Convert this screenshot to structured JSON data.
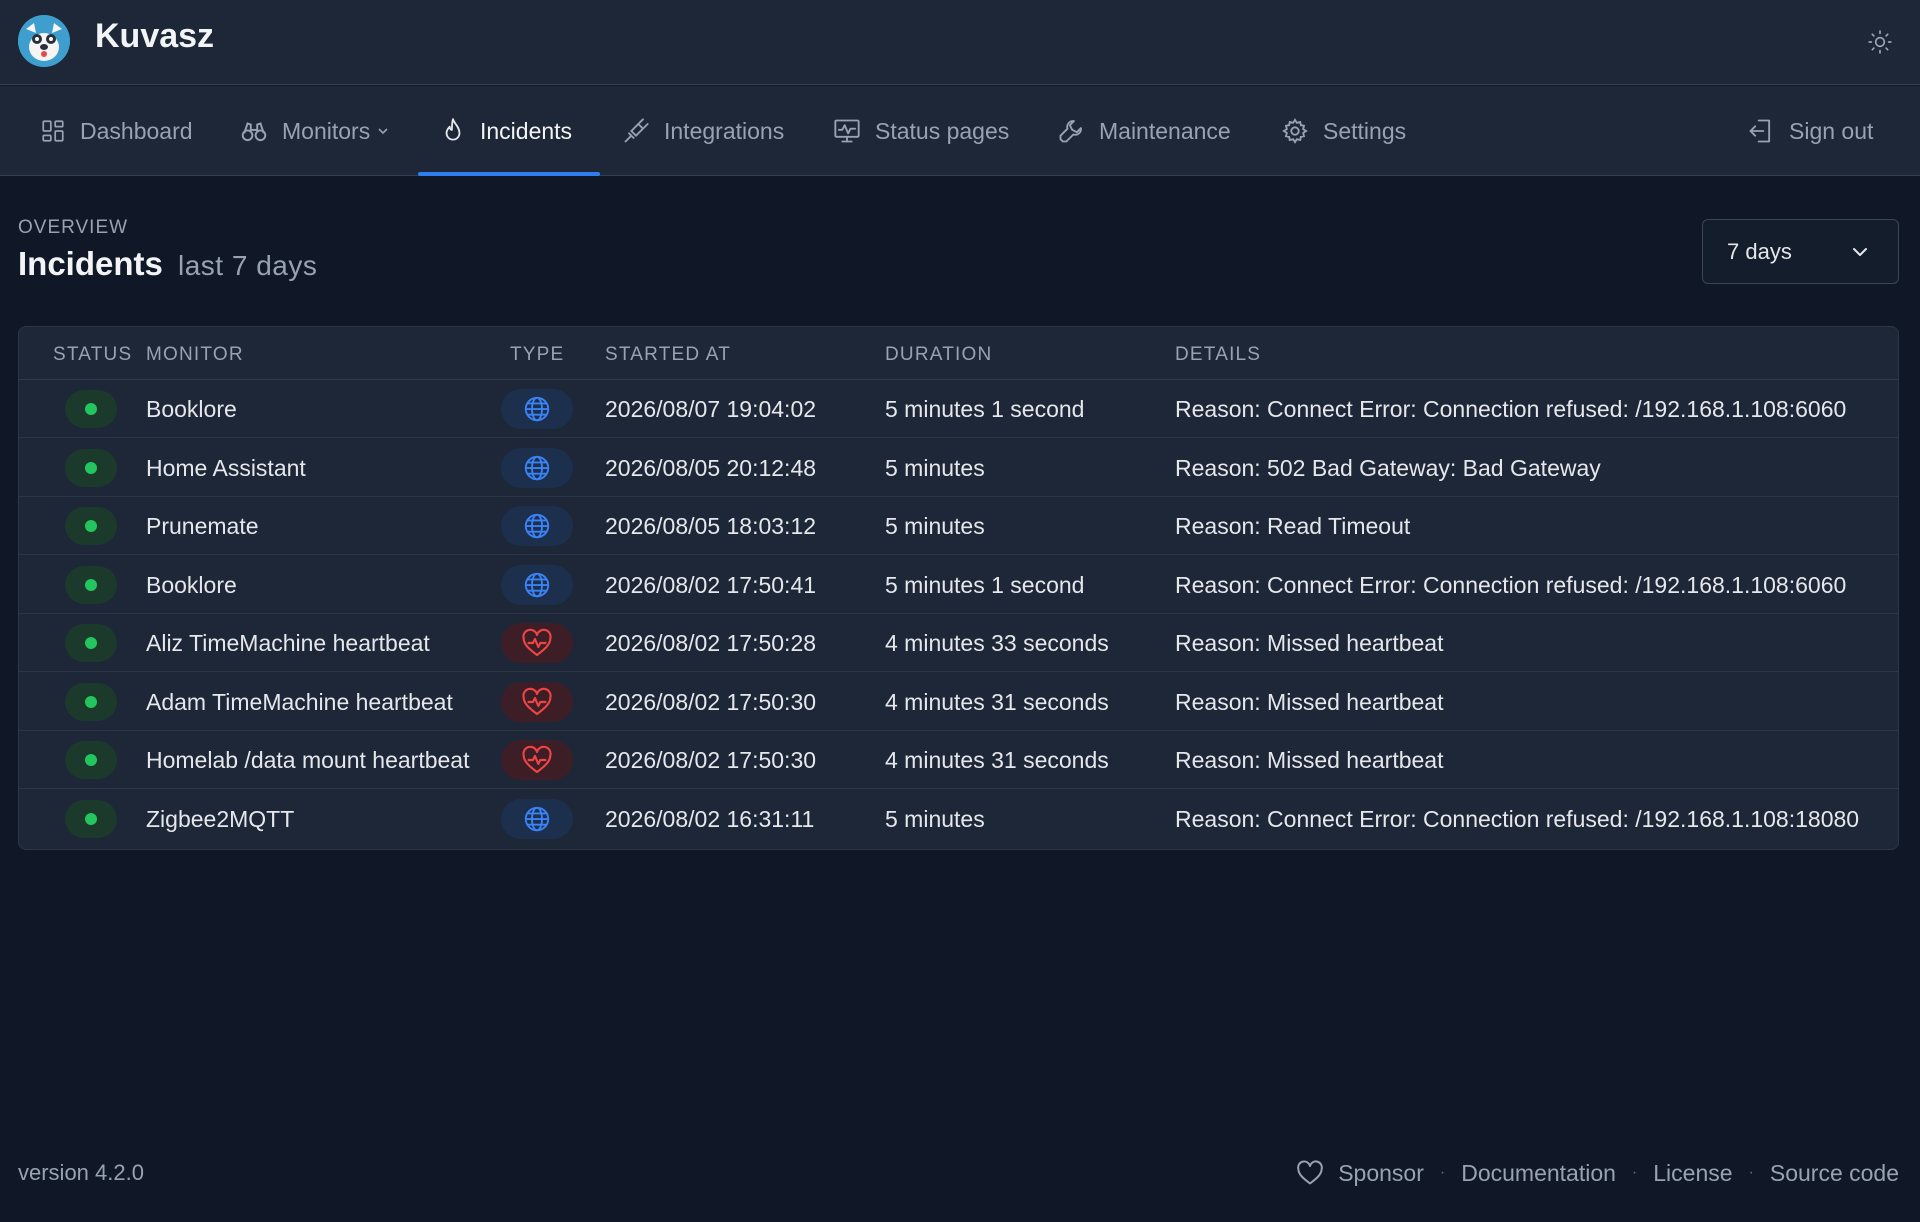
{
  "app": {
    "title": "Kuvasz"
  },
  "nav": {
    "items": [
      {
        "label": "Dashboard",
        "icon": "dashboard-icon"
      },
      {
        "label": "Monitors",
        "icon": "binoculars-icon"
      },
      {
        "label": "Incidents",
        "icon": "flame-icon",
        "active": true
      },
      {
        "label": "Integrations",
        "icon": "plug-icon"
      },
      {
        "label": "Status pages",
        "icon": "monitor-icon"
      },
      {
        "label": "Maintenance",
        "icon": "wrench-icon"
      },
      {
        "label": "Settings",
        "icon": "gear-icon"
      }
    ],
    "sign_out": "Sign out"
  },
  "page": {
    "overline": "OVERVIEW",
    "title": "Incidents",
    "subtitle": "last 7 days",
    "range_select": "7 days"
  },
  "table": {
    "headers": {
      "status": "STATUS",
      "monitor": "MONITOR",
      "type": "TYPE",
      "started_at": "STARTED AT",
      "duration": "DURATION",
      "details": "DETAILS"
    },
    "rows": [
      {
        "status": "up",
        "monitor": "Booklore",
        "type": "http",
        "started_at": "2026/08/07 19:04:02",
        "duration": "5 minutes 1 second",
        "details": "Reason: Connect Error: Connection refused: /192.168.1.108:6060"
      },
      {
        "status": "up",
        "monitor": "Home Assistant",
        "type": "http",
        "started_at": "2026/08/05 20:12:48",
        "duration": "5 minutes",
        "details": "Reason: 502 Bad Gateway: Bad Gateway"
      },
      {
        "status": "up",
        "monitor": "Prunemate",
        "type": "http",
        "started_at": "2026/08/05 18:03:12",
        "duration": "5 minutes",
        "details": "Reason: Read Timeout"
      },
      {
        "status": "up",
        "monitor": "Booklore",
        "type": "http",
        "started_at": "2026/08/02 17:50:41",
        "duration": "5 minutes 1 second",
        "details": "Reason: Connect Error: Connection refused: /192.168.1.108:6060"
      },
      {
        "status": "up",
        "monitor": "Aliz TimeMachine heartbeat",
        "type": "heartbeat",
        "started_at": "2026/08/02 17:50:28",
        "duration": "4 minutes 33 seconds",
        "details": "Reason: Missed heartbeat"
      },
      {
        "status": "up",
        "monitor": "Adam TimeMachine heartbeat",
        "type": "heartbeat",
        "started_at": "2026/08/02 17:50:30",
        "duration": "4 minutes 31 seconds",
        "details": "Reason: Missed heartbeat"
      },
      {
        "status": "up",
        "monitor": "Homelab /data mount heartbeat",
        "type": "heartbeat",
        "started_at": "2026/08/02 17:50:30",
        "duration": "4 minutes 31 seconds",
        "details": "Reason: Missed heartbeat"
      },
      {
        "status": "up",
        "monitor": "Zigbee2MQTT",
        "type": "http",
        "started_at": "2026/08/02 16:31:11",
        "duration": "5 minutes",
        "details": "Reason: Connect Error: Connection refused: /192.168.1.108:18080"
      }
    ]
  },
  "footer": {
    "version": "version 4.2.0",
    "links": {
      "sponsor": "Sponsor",
      "documentation": "Documentation",
      "license": "License",
      "source_code": "Source code"
    },
    "separator": "·"
  },
  "colors": {
    "background": "#101828",
    "header": "#1d2737",
    "accent": "#2e7ef0",
    "status_up": "#22c55e",
    "http_icon": "#3b82f6",
    "heartbeat_icon": "#ef4444"
  }
}
